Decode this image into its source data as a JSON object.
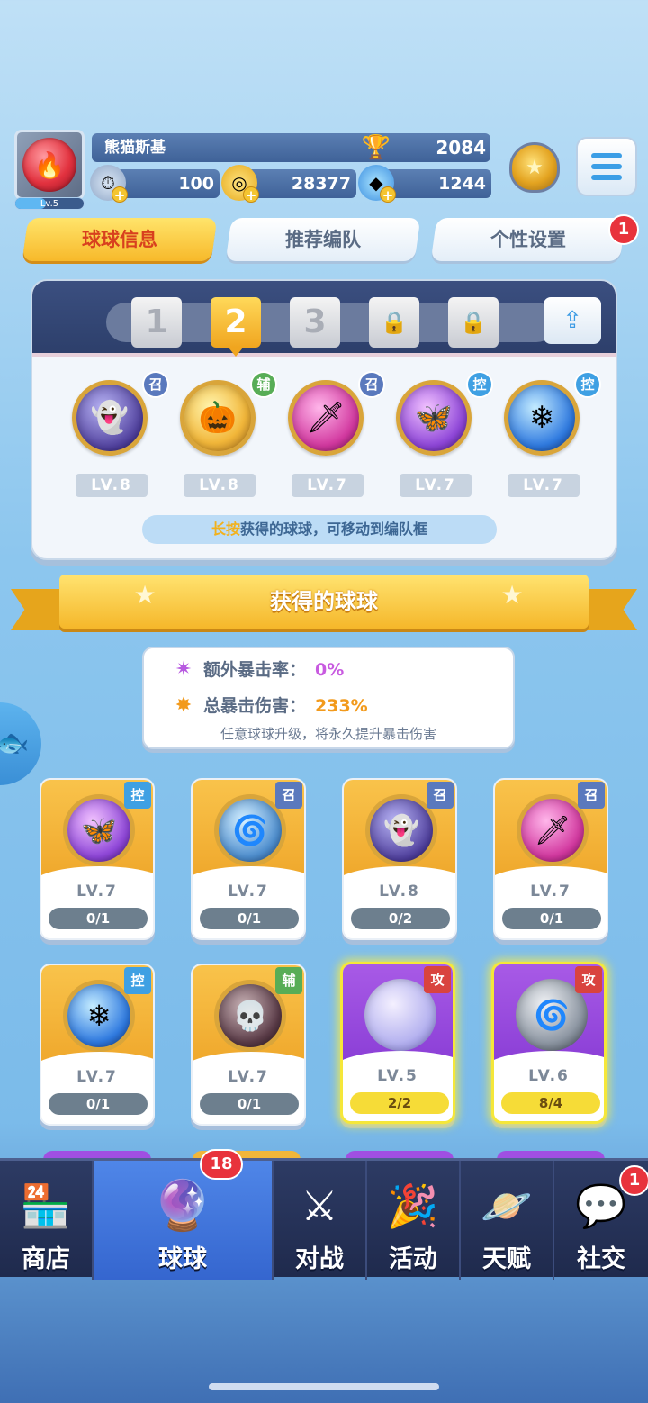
{
  "player": {
    "name": "熊猫斯基",
    "level_label": "Lv.5",
    "level_progress": 0.45,
    "trophies": "2084",
    "avatar_icon": "fire-icon",
    "rank_icon": "rank-badge-icon"
  },
  "currencies": [
    {
      "name": "energy",
      "value": "100",
      "icon": "energy-icon"
    },
    {
      "name": "coins",
      "value": "28377",
      "icon": "coin-icon"
    },
    {
      "name": "gems",
      "value": "1244",
      "icon": "gem-icon"
    }
  ],
  "tabs": [
    {
      "label": "球球信息",
      "active": true
    },
    {
      "label": "推荐编队",
      "active": false
    },
    {
      "label": "个性设置",
      "active": false,
      "badge": "1"
    }
  ],
  "team": {
    "slots": [
      {
        "label": "1",
        "state": "normal"
      },
      {
        "label": "2",
        "state": "active"
      },
      {
        "label": "3",
        "state": "normal"
      },
      {
        "label": "",
        "state": "locked"
      },
      {
        "label": "",
        "state": "locked"
      }
    ],
    "balls": [
      {
        "tag": "召",
        "level": "LV.8",
        "icon": "ghost-icon"
      },
      {
        "tag": "辅",
        "level": "LV.8",
        "icon": "pumpkin-icon"
      },
      {
        "tag": "召",
        "level": "LV.7",
        "icon": "blade-icon"
      },
      {
        "tag": "控",
        "level": "LV.7",
        "icon": "butterfly-icon"
      },
      {
        "tag": "控",
        "level": "LV.7",
        "icon": "snowflake-icon"
      }
    ],
    "hint_highlight": "长按",
    "hint_text": "获得的球球，可移动到编队框"
  },
  "section_title": "获得的球球",
  "crit": {
    "extra_rate_label": "额外暴击率：",
    "extra_rate_value": "0%",
    "total_damage_label": "总暴击伤害：",
    "total_damage_value": "233%",
    "note": "任意球球升级，将永久提升暴击伤害"
  },
  "cards": [
    {
      "tag": "控",
      "level": "LV.7",
      "progress": "0/1",
      "style": "gold",
      "icon": "butterfly-icon"
    },
    {
      "tag": "召",
      "level": "LV.7",
      "progress": "0/1",
      "style": "gold",
      "icon": "whirlwind-icon"
    },
    {
      "tag": "召",
      "level": "LV.8",
      "progress": "0/2",
      "style": "gold",
      "icon": "ghost-icon"
    },
    {
      "tag": "召",
      "level": "LV.7",
      "progress": "0/1",
      "style": "gold",
      "icon": "blade-icon"
    },
    {
      "tag": "控",
      "level": "LV.7",
      "progress": "0/1",
      "style": "gold",
      "icon": "snowflake-icon"
    },
    {
      "tag": "辅",
      "level": "LV.7",
      "progress": "0/1",
      "style": "gold",
      "icon": "skull-icon"
    },
    {
      "tag": "攻",
      "level": "LV.5",
      "progress": "2/2",
      "style": "purple",
      "icon": "bubble-icon"
    },
    {
      "tag": "攻",
      "level": "LV.6",
      "progress": "8/4",
      "style": "purple",
      "icon": "vortex-icon"
    }
  ],
  "nav": [
    {
      "label": "商店",
      "icon": "shop-icon",
      "active": false
    },
    {
      "label": "球球",
      "icon": "balls-icon",
      "active": true,
      "badge": "18"
    },
    {
      "label": "对战",
      "icon": "crossed-swords-icon",
      "active": false
    },
    {
      "label": "活动",
      "icon": "party-popper-icon",
      "active": false
    },
    {
      "label": "天赋",
      "icon": "planet-icon",
      "active": false
    },
    {
      "label": "社交",
      "icon": "chat-heart-icon",
      "active": false,
      "badge": "1"
    }
  ]
}
